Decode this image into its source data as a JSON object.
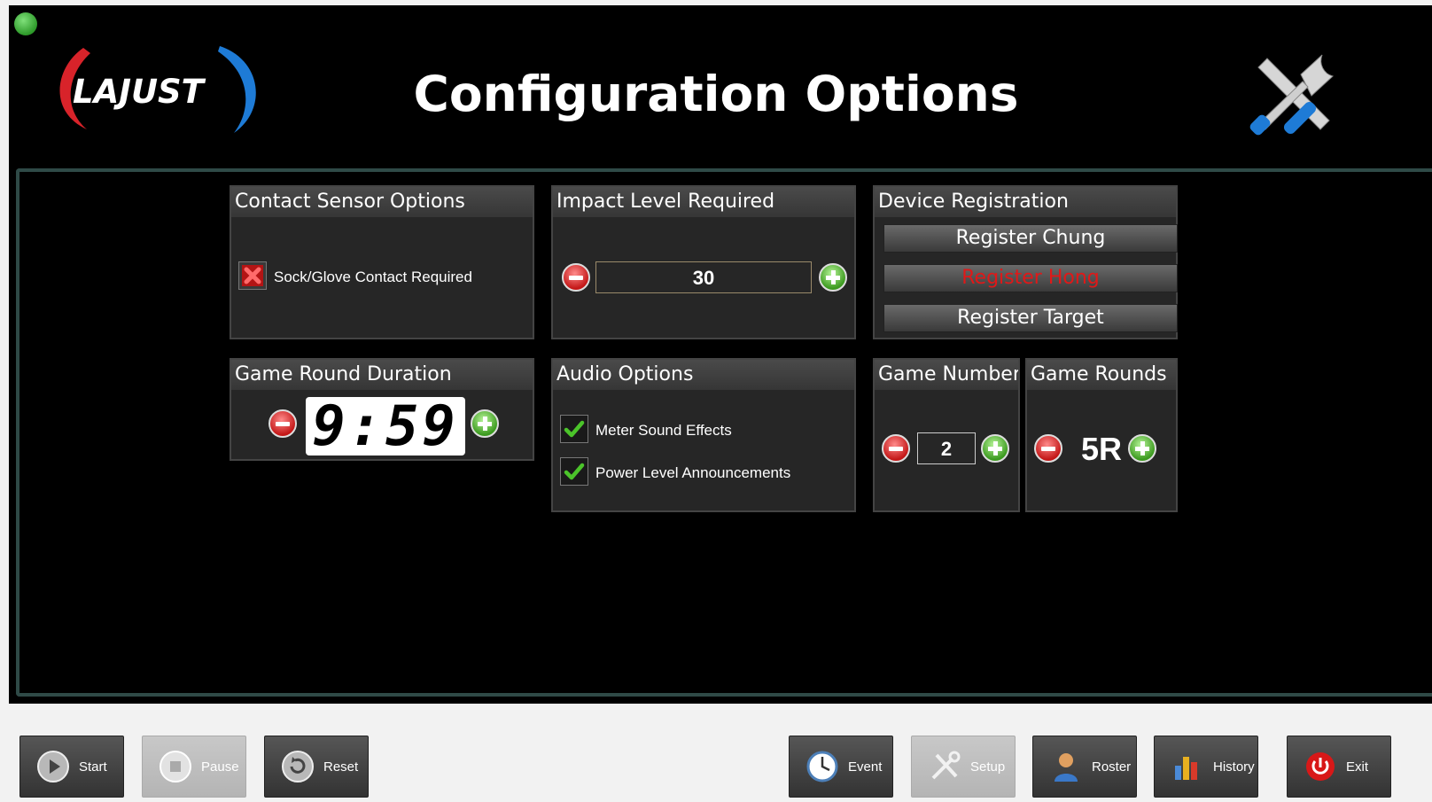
{
  "header": {
    "title": "Configuration Options",
    "logo_text": "LAJUST"
  },
  "contact_sensor": {
    "title": "Contact Sensor Options",
    "sock_glove_label": "Sock/Glove Contact Required",
    "sock_glove_checked": false
  },
  "impact_level": {
    "title": "Impact Level Required",
    "value": "30"
  },
  "device_registration": {
    "title": "Device Registration",
    "buttons": [
      {
        "label": "Register Chung",
        "color": "#ffffff"
      },
      {
        "label": "Register Hong",
        "color": "#e01818"
      },
      {
        "label": "Register Target",
        "color": "#ffffff"
      }
    ]
  },
  "round_duration": {
    "title": "Game Round Duration",
    "time": "9:59"
  },
  "audio": {
    "title": "Audio Options",
    "options": [
      {
        "label": "Meter Sound Effects",
        "checked": true
      },
      {
        "label": "Power Level Announcements",
        "checked": true
      }
    ]
  },
  "game_number": {
    "title": "Game Number",
    "value": "2"
  },
  "game_rounds": {
    "title": "Game Rounds",
    "value": "5R"
  },
  "toolbar": {
    "start": "Start",
    "pause": "Pause",
    "reset": "Reset",
    "event": "Event",
    "setup": "Setup",
    "roster": "Roster",
    "history": "History",
    "exit": "Exit"
  },
  "colors": {
    "accent_green": "#3c9a1f",
    "minus_red": "#c41818",
    "panel_border": "#2f4a47"
  }
}
